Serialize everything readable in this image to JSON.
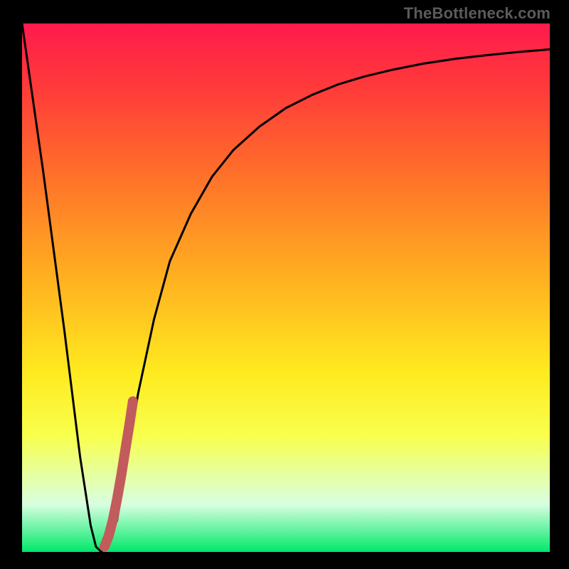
{
  "watermark": "TheBottleneck.com",
  "chart_data": {
    "type": "line",
    "title": "",
    "xlabel": "",
    "ylabel": "",
    "xlim": [
      0,
      100
    ],
    "ylim": [
      0,
      100
    ],
    "series": [
      {
        "name": "bottleneck-curve",
        "x": [
          0,
          4,
          8,
          11,
          13,
          14,
          15,
          16,
          18,
          20,
          22,
          25,
          28,
          32,
          36,
          40,
          45,
          50,
          55,
          60,
          65,
          70,
          76,
          82,
          88,
          94,
          100
        ],
        "y": [
          100,
          72,
          42,
          18,
          5,
          1,
          0,
          1,
          6,
          18,
          30,
          44,
          55,
          64,
          71,
          76,
          80.5,
          84,
          86.5,
          88.5,
          90,
          91.2,
          92.4,
          93.3,
          94,
          94.6,
          95.1
        ]
      },
      {
        "name": "highlight-segment",
        "x": [
          15.6,
          16.4,
          17.2,
          18.0,
          18.8,
          19.6,
          20.4,
          21.0
        ],
        "y": [
          1.0,
          3.0,
          6.0,
          10.0,
          14.5,
          19.5,
          24.5,
          28.5
        ]
      }
    ],
    "colors": {
      "curve": "#000000",
      "highlight": "#c25b5b"
    }
  }
}
